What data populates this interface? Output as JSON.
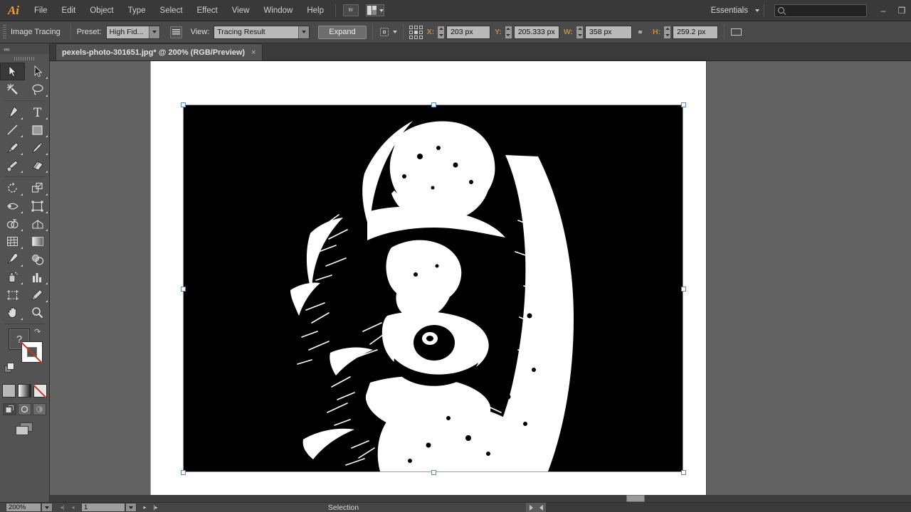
{
  "app": {
    "name": "Adobe Illustrator",
    "logo": "Ai"
  },
  "menubar": {
    "items": [
      "File",
      "Edit",
      "Object",
      "Type",
      "Select",
      "Effect",
      "View",
      "Window",
      "Help"
    ],
    "bridge_label": "Br",
    "workspace": "Essentials",
    "search_placeholder": "",
    "search_value": "",
    "minimize": "–",
    "restore": "❐"
  },
  "controlbar": {
    "panel_title": "Image Tracing",
    "preset_label": "Preset:",
    "preset_value": "High Fid...",
    "view_label": "View:",
    "view_value": "Tracing Result",
    "expand_label": "Expand",
    "x_label": "X:",
    "x_value": "203 px",
    "y_label": "Y:",
    "y_value": "205.333 px",
    "w_label": "W:",
    "w_value": "358 px",
    "h_label": "H:",
    "h_value": "259.2 px"
  },
  "tabs": [
    {
      "title": "pexels-photo-301651.jpg* @ 200% (RGB/Preview)",
      "close": "×",
      "active": true
    }
  ],
  "toolbar": {
    "collapse": "««",
    "tools": [
      {
        "name": "selection-tool",
        "active": true
      },
      {
        "name": "direct-selection-tool",
        "active": false
      },
      {
        "name": "magic-wand-tool",
        "active": false
      },
      {
        "name": "lasso-tool",
        "active": false
      },
      {
        "name": "pen-tool",
        "active": false
      },
      {
        "name": "type-tool",
        "active": false
      },
      {
        "name": "line-segment-tool",
        "active": false
      },
      {
        "name": "rectangle-tool",
        "active": false
      },
      {
        "name": "paintbrush-tool",
        "active": false
      },
      {
        "name": "pencil-tool",
        "active": false
      },
      {
        "name": "blob-brush-tool",
        "active": false
      },
      {
        "name": "eraser-tool",
        "active": false
      },
      {
        "name": "rotate-tool",
        "active": false
      },
      {
        "name": "scale-tool",
        "active": false
      },
      {
        "name": "width-tool",
        "active": false
      },
      {
        "name": "free-transform-tool",
        "active": false
      },
      {
        "name": "shape-builder-tool",
        "active": false
      },
      {
        "name": "perspective-grid-tool",
        "active": false
      },
      {
        "name": "mesh-tool",
        "active": false
      },
      {
        "name": "gradient-tool",
        "active": false
      },
      {
        "name": "eyedropper-tool",
        "active": false
      },
      {
        "name": "blend-tool",
        "active": false
      },
      {
        "name": "symbol-sprayer-tool",
        "active": false
      },
      {
        "name": "column-graph-tool",
        "active": false
      },
      {
        "name": "artboard-tool",
        "active": false
      },
      {
        "name": "slice-tool",
        "active": false
      },
      {
        "name": "hand-tool",
        "active": false
      },
      {
        "name": "zoom-tool",
        "active": false
      }
    ],
    "fill_value": "?",
    "stroke_value": "none",
    "color_modes": [
      "color",
      "gradient",
      "none"
    ],
    "draw_modes": [
      "draw-normal",
      "draw-behind",
      "draw-inside"
    ],
    "screen_mode": "change-screen-mode"
  },
  "document": {
    "artboard_background": "#ffffff",
    "canvas_background": "#626262",
    "image_background": "#000000",
    "image_foreground": "#ffffff",
    "selection_color": "#7ba4d9",
    "subject": "traced high-contrast portrait of bearded man"
  },
  "statusbar": {
    "zoom": "200%",
    "page": "1",
    "status": "Selection"
  }
}
